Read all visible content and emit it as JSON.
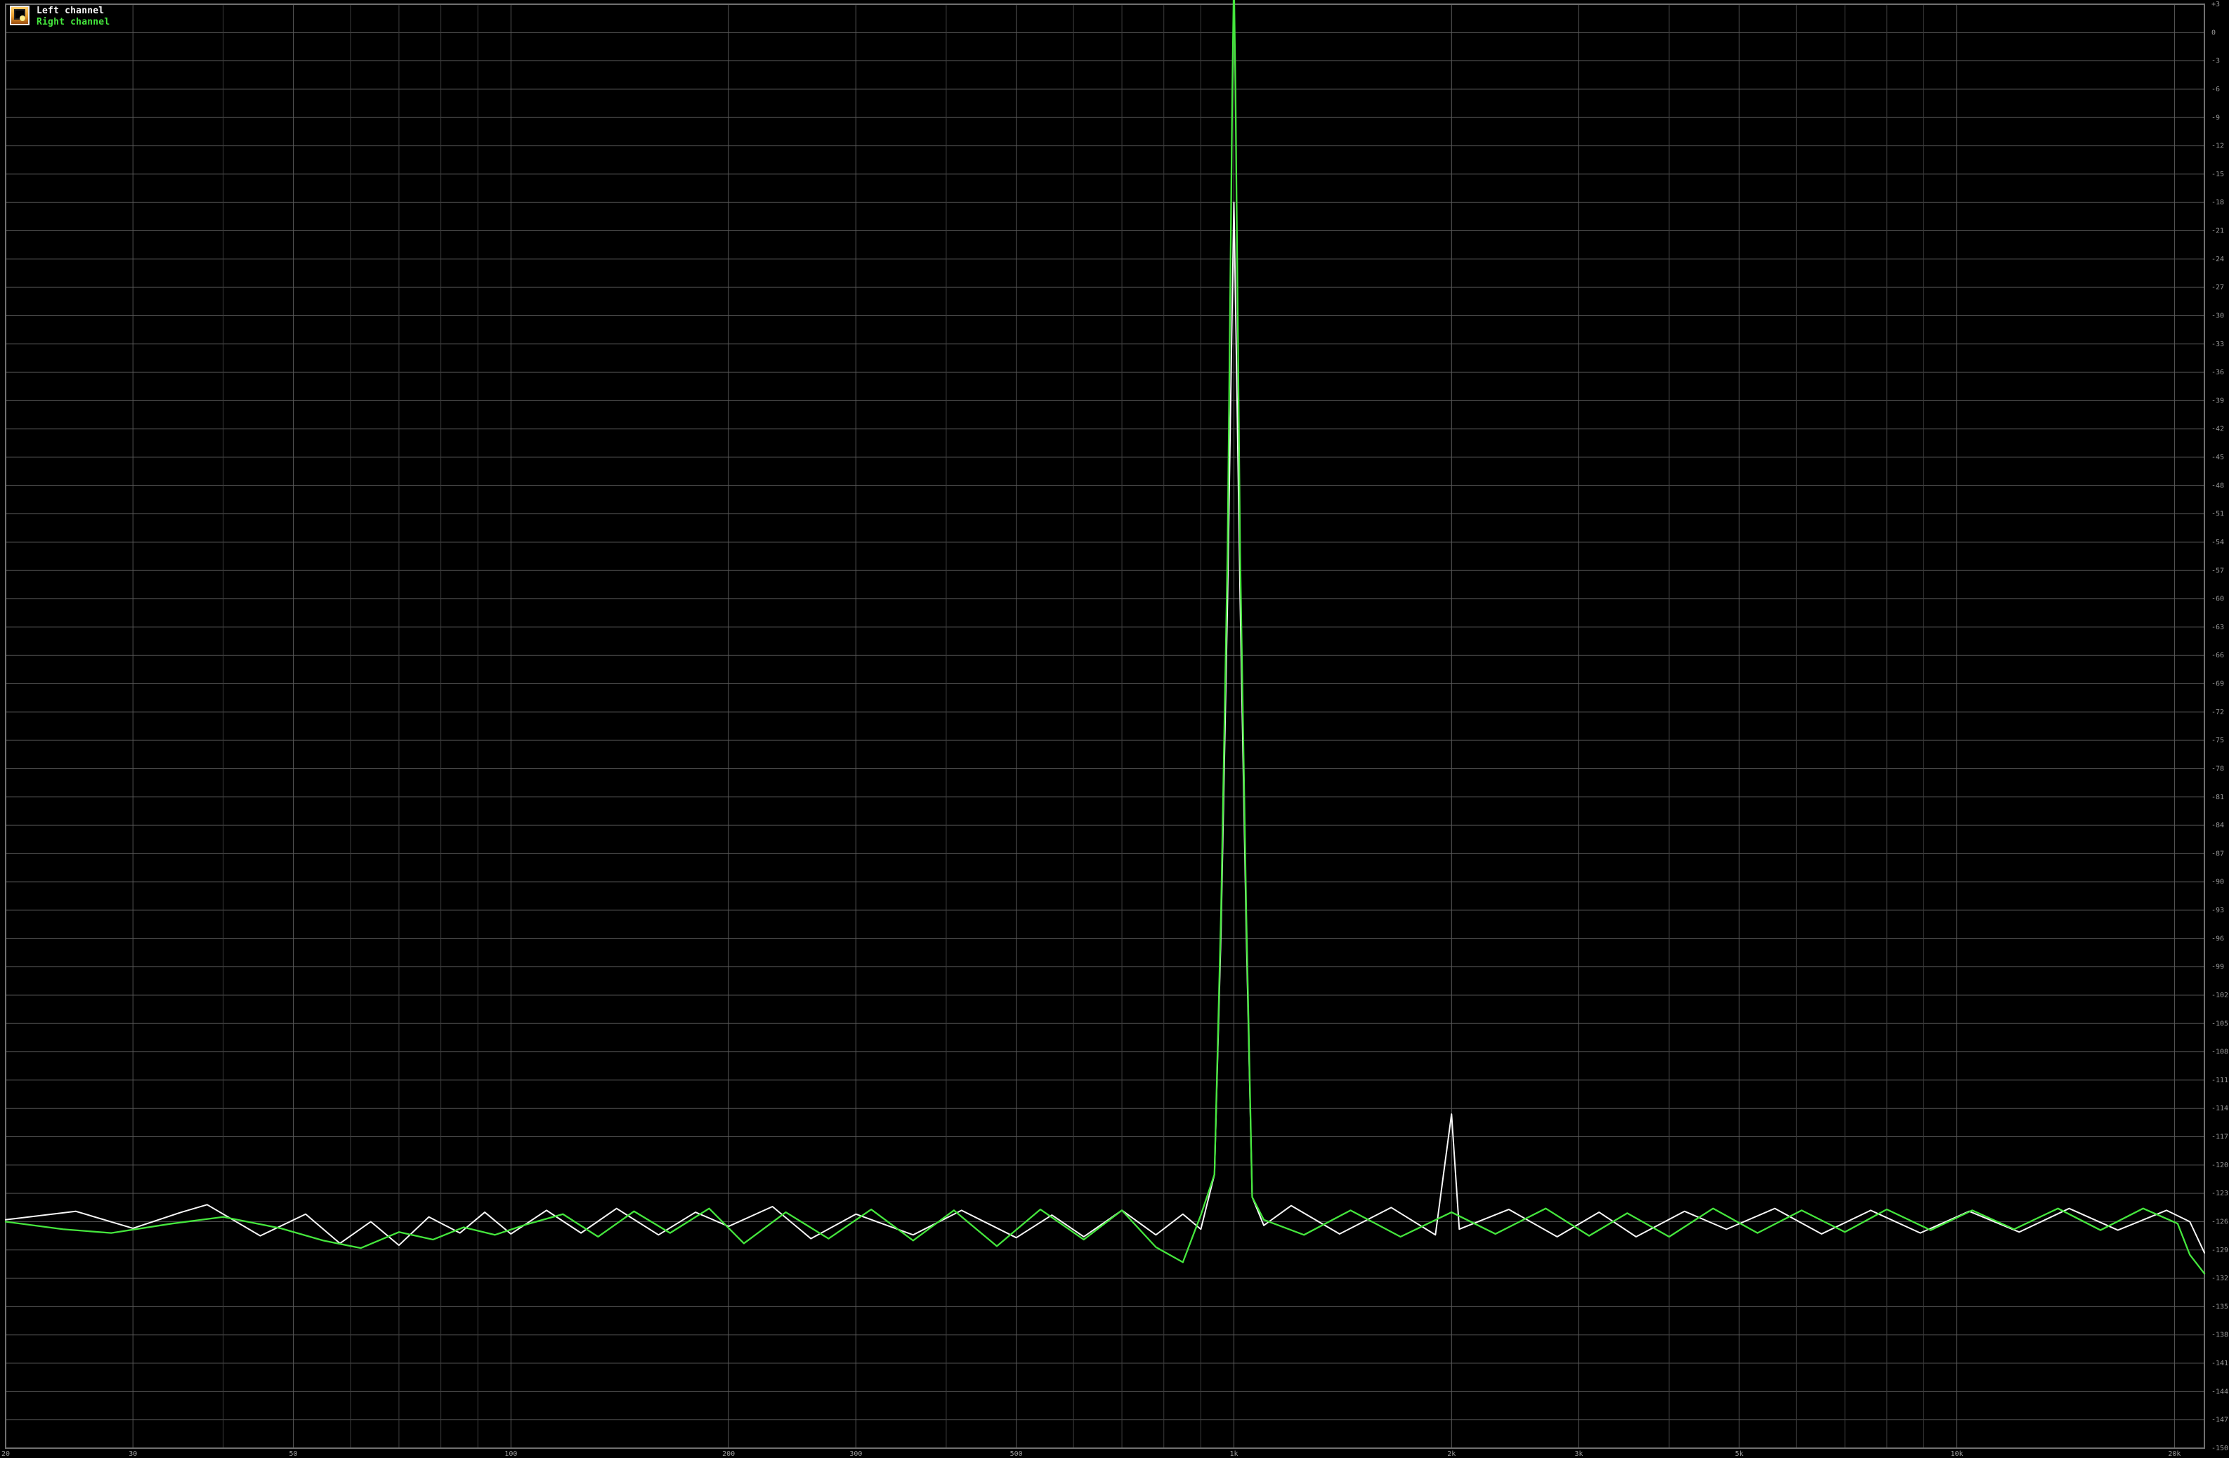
{
  "legend": {
    "left_label": "Left channel",
    "right_label": "Right channel",
    "right_suffix": "",
    "left_color": "#f7f7f7",
    "right_color": "#45e63d",
    "icon": "spectrum-analyzer-icon"
  },
  "chart_data": {
    "type": "line",
    "title": "",
    "xlabel": "",
    "ylabel": "",
    "xscale": "log",
    "grid": true,
    "legend_position": "top-left",
    "background": "#000000",
    "grid_color": "#505050",
    "y_range_db": [
      -150,
      3
    ],
    "y_major_step_db": 3,
    "x_tick_labels": [
      "20",
      "30",
      "50",
      "100",
      "200",
      "300",
      "500",
      "1k",
      "2k",
      "3k",
      "5k",
      "10k",
      "20k"
    ],
    "series": [
      {
        "name": "Left channel",
        "color": "#f7f7f7",
        "points": [
          [
            20,
            -125.8
          ],
          [
            25,
            -124.9
          ],
          [
            30,
            -126.7
          ],
          [
            35,
            -125.0
          ],
          [
            38,
            -124.2
          ],
          [
            45,
            -127.5
          ],
          [
            52,
            -125.2
          ],
          [
            58,
            -128.3
          ],
          [
            64,
            -126.0
          ],
          [
            70,
            -128.5
          ],
          [
            77,
            -125.5
          ],
          [
            85,
            -127.2
          ],
          [
            92,
            -125.0
          ],
          [
            100,
            -127.3
          ],
          [
            112,
            -124.8
          ],
          [
            125,
            -127.2
          ],
          [
            140,
            -124.6
          ],
          [
            160,
            -127.4
          ],
          [
            180,
            -125.0
          ],
          [
            200,
            -126.5
          ],
          [
            230,
            -124.4
          ],
          [
            260,
            -127.8
          ],
          [
            300,
            -125.2
          ],
          [
            360,
            -127.4
          ],
          [
            420,
            -124.8
          ],
          [
            500,
            -127.7
          ],
          [
            560,
            -125.3
          ],
          [
            620,
            -127.6
          ],
          [
            700,
            -124.8
          ],
          [
            780,
            -127.4
          ],
          [
            850,
            -125.2
          ],
          [
            900,
            -126.8
          ],
          [
            940,
            -121.0
          ],
          [
            960,
            -95.0
          ],
          [
            980,
            -60.0
          ],
          [
            995,
            -28.0
          ],
          [
            1000,
            -18.0
          ],
          [
            1005,
            -28.0
          ],
          [
            1020,
            -60.0
          ],
          [
            1040,
            -95.0
          ],
          [
            1060,
            -123.4
          ],
          [
            1100,
            -126.4
          ],
          [
            1200,
            -124.3
          ],
          [
            1400,
            -127.3
          ],
          [
            1650,
            -124.5
          ],
          [
            1900,
            -127.4
          ],
          [
            2000,
            -114.6
          ],
          [
            2050,
            -126.8
          ],
          [
            2400,
            -124.7
          ],
          [
            2800,
            -127.6
          ],
          [
            3200,
            -125.0
          ],
          [
            3600,
            -127.6
          ],
          [
            4200,
            -124.9
          ],
          [
            4800,
            -126.8
          ],
          [
            5600,
            -124.6
          ],
          [
            6500,
            -127.3
          ],
          [
            7600,
            -124.8
          ],
          [
            8900,
            -127.2
          ],
          [
            10400,
            -124.9
          ],
          [
            12200,
            -127.1
          ],
          [
            14300,
            -124.6
          ],
          [
            16700,
            -126.9
          ],
          [
            19500,
            -124.8
          ],
          [
            21000,
            -126.0
          ],
          [
            22000,
            -129.3
          ]
        ]
      },
      {
        "name": "Right channel",
        "color": "#45e63d",
        "points": [
          [
            20,
            -126.0
          ],
          [
            24,
            -126.8
          ],
          [
            28,
            -127.2
          ],
          [
            34,
            -126.2
          ],
          [
            40,
            -125.5
          ],
          [
            48,
            -126.7
          ],
          [
            55,
            -128.0
          ],
          [
            62,
            -128.8
          ],
          [
            70,
            -127.1
          ],
          [
            78,
            -127.9
          ],
          [
            86,
            -126.6
          ],
          [
            95,
            -127.4
          ],
          [
            105,
            -126.3
          ],
          [
            118,
            -125.2
          ],
          [
            132,
            -127.6
          ],
          [
            148,
            -124.9
          ],
          [
            166,
            -127.2
          ],
          [
            188,
            -124.6
          ],
          [
            210,
            -128.3
          ],
          [
            240,
            -125.0
          ],
          [
            275,
            -127.8
          ],
          [
            315,
            -124.7
          ],
          [
            360,
            -128.0
          ],
          [
            410,
            -124.8
          ],
          [
            470,
            -128.6
          ],
          [
            540,
            -124.7
          ],
          [
            620,
            -127.9
          ],
          [
            700,
            -124.8
          ],
          [
            780,
            -128.7
          ],
          [
            850,
            -130.3
          ],
          [
            900,
            -125.3
          ],
          [
            940,
            -121.0
          ],
          [
            960,
            -93.0
          ],
          [
            980,
            -55.0
          ],
          [
            995,
            -6.0
          ],
          [
            1000,
            6.0
          ],
          [
            1005,
            -6.0
          ],
          [
            1020,
            -55.0
          ],
          [
            1040,
            -93.0
          ],
          [
            1060,
            -123.4
          ],
          [
            1100,
            -125.8
          ],
          [
            1250,
            -127.4
          ],
          [
            1450,
            -124.8
          ],
          [
            1700,
            -127.6
          ],
          [
            2000,
            -125.0
          ],
          [
            2300,
            -127.3
          ],
          [
            2700,
            -124.6
          ],
          [
            3100,
            -127.5
          ],
          [
            3500,
            -125.1
          ],
          [
            4000,
            -127.6
          ],
          [
            4600,
            -124.6
          ],
          [
            5300,
            -127.2
          ],
          [
            6100,
            -124.8
          ],
          [
            7000,
            -127.1
          ],
          [
            8000,
            -124.7
          ],
          [
            9200,
            -126.9
          ],
          [
            10500,
            -124.8
          ],
          [
            12000,
            -126.8
          ],
          [
            13800,
            -124.6
          ],
          [
            15800,
            -126.9
          ],
          [
            18100,
            -124.6
          ],
          [
            20200,
            -126.2
          ],
          [
            21000,
            -129.5
          ],
          [
            22000,
            -131.5
          ]
        ]
      }
    ]
  }
}
